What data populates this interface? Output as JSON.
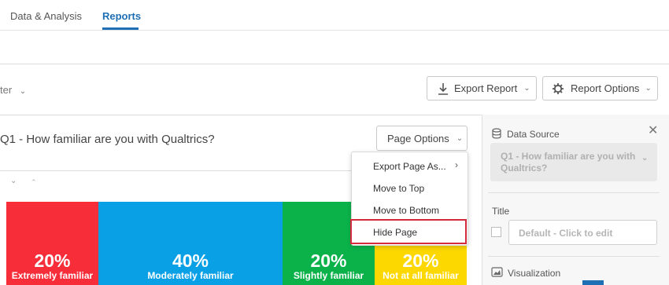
{
  "tabs": [
    {
      "label": "Data & Analysis"
    },
    {
      "label": "Reports"
    }
  ],
  "toolbar": {
    "filter_label": "ter",
    "export_report": "Export Report",
    "report_options": "Report Options"
  },
  "page": {
    "title": "Q1 - How familiar are you with Qualtrics?",
    "page_options": "Page Options"
  },
  "menu": {
    "items": [
      {
        "label": "Export Page As..."
      },
      {
        "label": "Move to Top"
      },
      {
        "label": "Move to Bottom"
      },
      {
        "label": "Hide Page"
      }
    ]
  },
  "chart_data": {
    "type": "bar",
    "categories": [
      "Extremely familiar",
      "Moderately familiar",
      "Slightly familiar",
      "Not at all familiar"
    ],
    "values": [
      20,
      40,
      20,
      20
    ],
    "value_labels": [
      "20%",
      "40%",
      "20%",
      "20%"
    ],
    "colors": [
      "#f72d3a",
      "#0aa0e6",
      "#0bb24a",
      "#fdd800"
    ]
  },
  "panel": {
    "data_source_label": "Data Source",
    "data_source_value": "Q1 - How familiar are you with Qualtrics?",
    "title_label": "Title",
    "title_placeholder": "Default - Click to edit",
    "visualization_label": "Visualization"
  },
  "colors": {
    "accent": "#1f6fb5",
    "highlight": "#d42a3b"
  }
}
